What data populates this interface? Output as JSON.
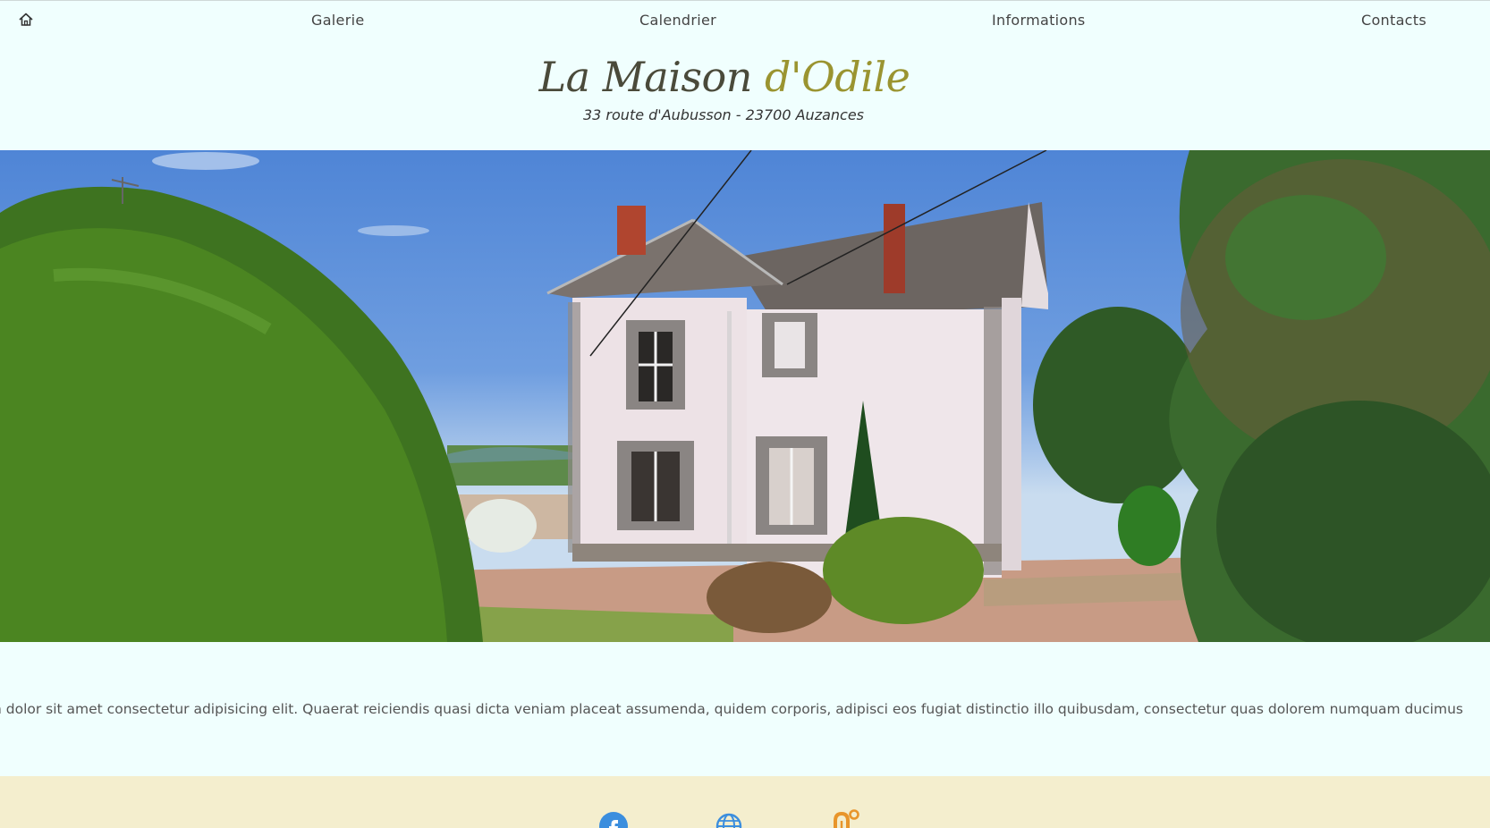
{
  "nav": {
    "home_icon": "home-icon",
    "items": [
      {
        "label": "Galerie"
      },
      {
        "label": "Calendrier"
      },
      {
        "label": "Informations"
      },
      {
        "label": "Contacts"
      }
    ]
  },
  "header": {
    "title_part1": "La Maison ",
    "title_part2": "d'Odile",
    "address": "33 route d'Aubusson - 23700 Auzances"
  },
  "hero": {
    "image": "house-photo"
  },
  "marquee": {
    "text": "n dolor sit amet consectetur adipisicing elit. Quaerat reiciendis quasi dicta veniam placeat assumenda, quidem corporis, adipisci eos fugiat distinctio illo quibusdam, consectetur quas dolorem numquam ducimus"
  },
  "footer": {
    "icons": [
      "facebook-icon",
      "globe-icon",
      "partner-logo-icon"
    ]
  },
  "colors": {
    "background": "#f0fffe",
    "footer_bg": "#f4eece",
    "title_gold": "#9a9430",
    "facebook_blue": "#3b8ede",
    "logo_orange": "#e8952b"
  }
}
